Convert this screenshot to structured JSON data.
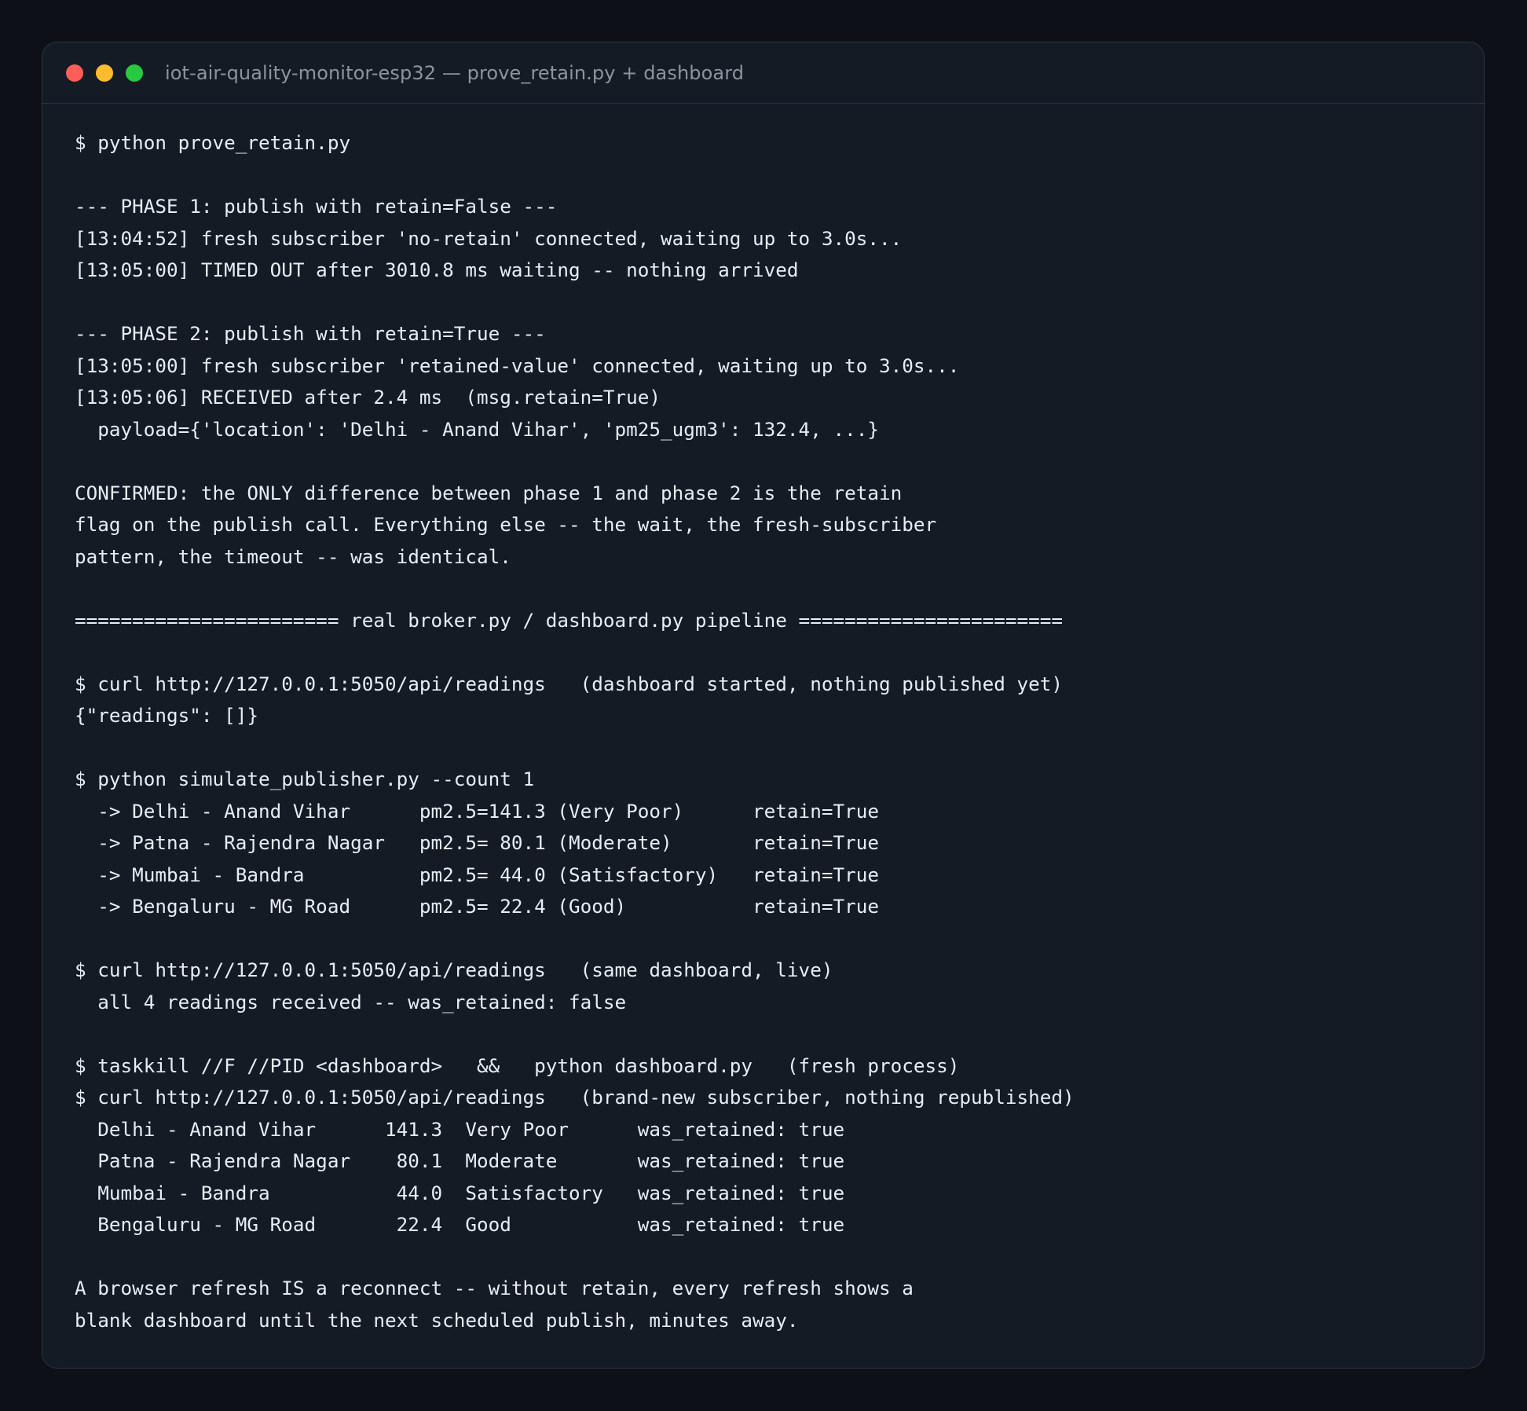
{
  "window": {
    "title": "iot-air-quality-monitor-esp32 — prove_retain.py + dashboard",
    "traffic_lights": {
      "close_color": "#ff5f57",
      "minimize_color": "#febc2e",
      "maximize_color": "#28c840"
    }
  },
  "terminal": {
    "lines": [
      "$ python prove_retain.py",
      "",
      "--- PHASE 1: publish with retain=False ---",
      "[13:04:52] fresh subscriber 'no-retain' connected, waiting up to 3.0s...",
      "[13:05:00] TIMED OUT after 3010.8 ms waiting -- nothing arrived",
      "",
      "--- PHASE 2: publish with retain=True ---",
      "[13:05:00] fresh subscriber 'retained-value' connected, waiting up to 3.0s...",
      "[13:05:06] RECEIVED after 2.4 ms  (msg.retain=True)",
      "  payload={'location': 'Delhi - Anand Vihar', 'pm25_ugm3': 132.4, ...}",
      "",
      "CONFIRMED: the ONLY difference between phase 1 and phase 2 is the retain",
      "flag on the publish call. Everything else -- the wait, the fresh-subscriber",
      "pattern, the timeout -- was identical.",
      "",
      "======================= real broker.py / dashboard.py pipeline =======================",
      "",
      "$ curl http://127.0.0.1:5050/api/readings   (dashboard started, nothing published yet)",
      "{\"readings\": []}",
      "",
      "$ python simulate_publisher.py --count 1",
      "  -> Delhi - Anand Vihar      pm2.5=141.3 (Very Poor)      retain=True",
      "  -> Patna - Rajendra Nagar   pm2.5= 80.1 (Moderate)       retain=True",
      "  -> Mumbai - Bandra          pm2.5= 44.0 (Satisfactory)   retain=True",
      "  -> Bengaluru - MG Road      pm2.5= 22.4 (Good)           retain=True",
      "",
      "$ curl http://127.0.0.1:5050/api/readings   (same dashboard, live)",
      "  all 4 readings received -- was_retained: false",
      "",
      "$ taskkill //F //PID <dashboard>   &&   python dashboard.py   (fresh process)",
      "$ curl http://127.0.0.1:5050/api/readings   (brand-new subscriber, nothing republished)",
      "  Delhi - Anand Vihar      141.3  Very Poor      was_retained: true",
      "  Patna - Rajendra Nagar    80.1  Moderate       was_retained: true",
      "  Mumbai - Bandra           44.0  Satisfactory   was_retained: true",
      "  Bengaluru - MG Road       22.4  Good           was_retained: true",
      "",
      "A browser refresh IS a reconnect -- without retain, every refresh shows a",
      "blank dashboard until the next scheduled publish, minutes away."
    ]
  }
}
